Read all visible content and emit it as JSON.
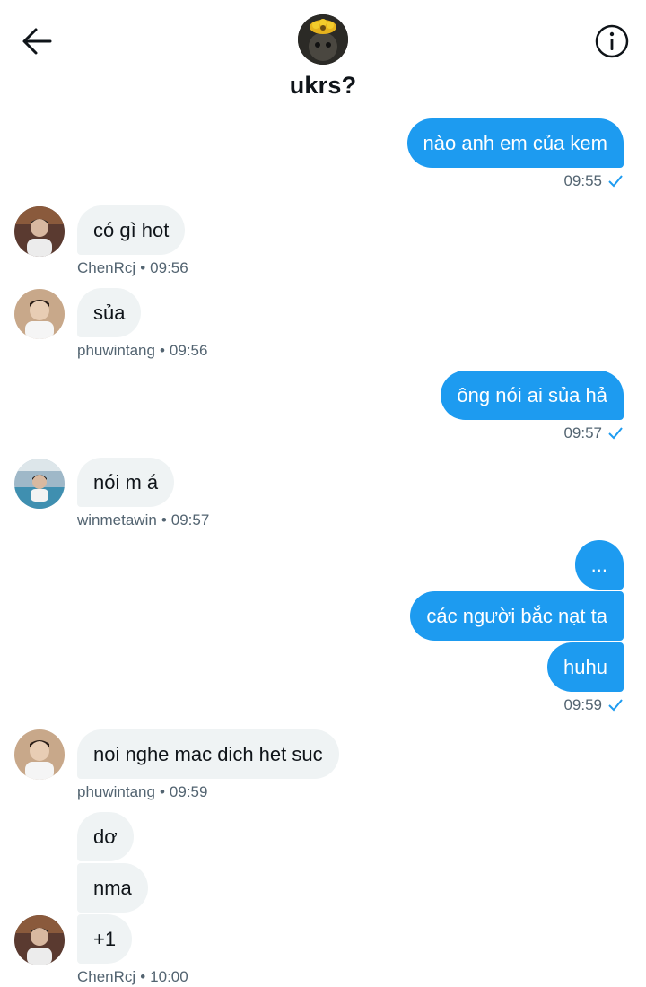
{
  "header": {
    "title": "ukrs?",
    "back_icon": "arrow-left-icon",
    "info_icon": "info-icon"
  },
  "colors": {
    "accent": "#1d9bf0",
    "incoming_bubble": "#eff3f4",
    "meta_text": "#536471"
  },
  "messages": [
    {
      "id": 1,
      "dir": "out",
      "text": "nào anh em của kem",
      "time": "09:55"
    },
    {
      "id": 2,
      "dir": "in",
      "text": "có gì hot",
      "sender": "ChenRcj",
      "time": "09:56"
    },
    {
      "id": 3,
      "dir": "in",
      "text": "sủa",
      "sender": "phuwintang",
      "time": "09:56"
    },
    {
      "id": 4,
      "dir": "out",
      "text": "ông nói ai sủa hả",
      "time": "09:57"
    },
    {
      "id": 5,
      "dir": "in",
      "text": "nói m á",
      "sender": "winmetawin",
      "time": "09:57"
    },
    {
      "id": 6,
      "dir": "out",
      "text": "...",
      "time": ""
    },
    {
      "id": 7,
      "dir": "out",
      "text": "các người bắc nạt ta",
      "time": ""
    },
    {
      "id": 8,
      "dir": "out",
      "text": "huhu",
      "time": "09:59"
    },
    {
      "id": 9,
      "dir": "in",
      "text": "noi nghe mac dich het suc",
      "sender": "phuwintang",
      "time": "09:59"
    },
    {
      "id": 10,
      "dir": "in",
      "text": "dơ",
      "sender": "",
      "time": ""
    },
    {
      "id": 11,
      "dir": "in",
      "text": "nma",
      "sender": "",
      "time": ""
    },
    {
      "id": 12,
      "dir": "in",
      "text": "+1",
      "sender": "ChenRcj",
      "time": "10:00"
    }
  ],
  "meta_separator": "•"
}
